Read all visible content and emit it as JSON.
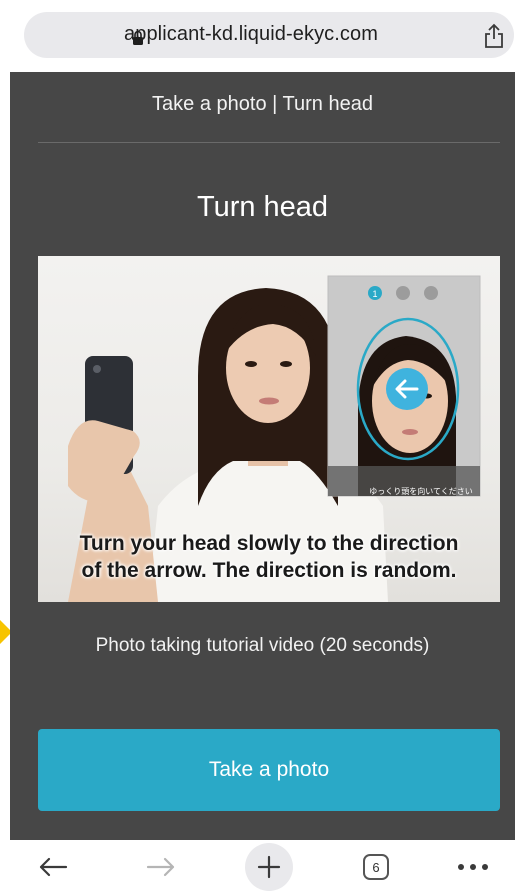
{
  "browser": {
    "url": "applicant-kd.liquid-ekyc.com",
    "tab_count": "6"
  },
  "header": {
    "breadcrumb": "Take a photo | Turn head"
  },
  "main": {
    "title": "Turn head",
    "video": {
      "caption_line1": "Turn your head slowly to the direction",
      "caption_line2": "of the arrow. The direction is random.",
      "phone_caption": "ゆっくり頭を向いてください"
    },
    "tutorial_label": "Photo taking tutorial video (20 seconds)",
    "cta_label": "Take a photo"
  },
  "colors": {
    "page_bg": "#474747",
    "accent": "#2aa9c7",
    "urlbar_bg": "#e9e9ec"
  },
  "icons": [
    "lock-icon",
    "share-icon",
    "back-arrow-icon",
    "forward-arrow-icon",
    "plus-icon",
    "more-icon",
    "arrow-left-icon"
  ]
}
